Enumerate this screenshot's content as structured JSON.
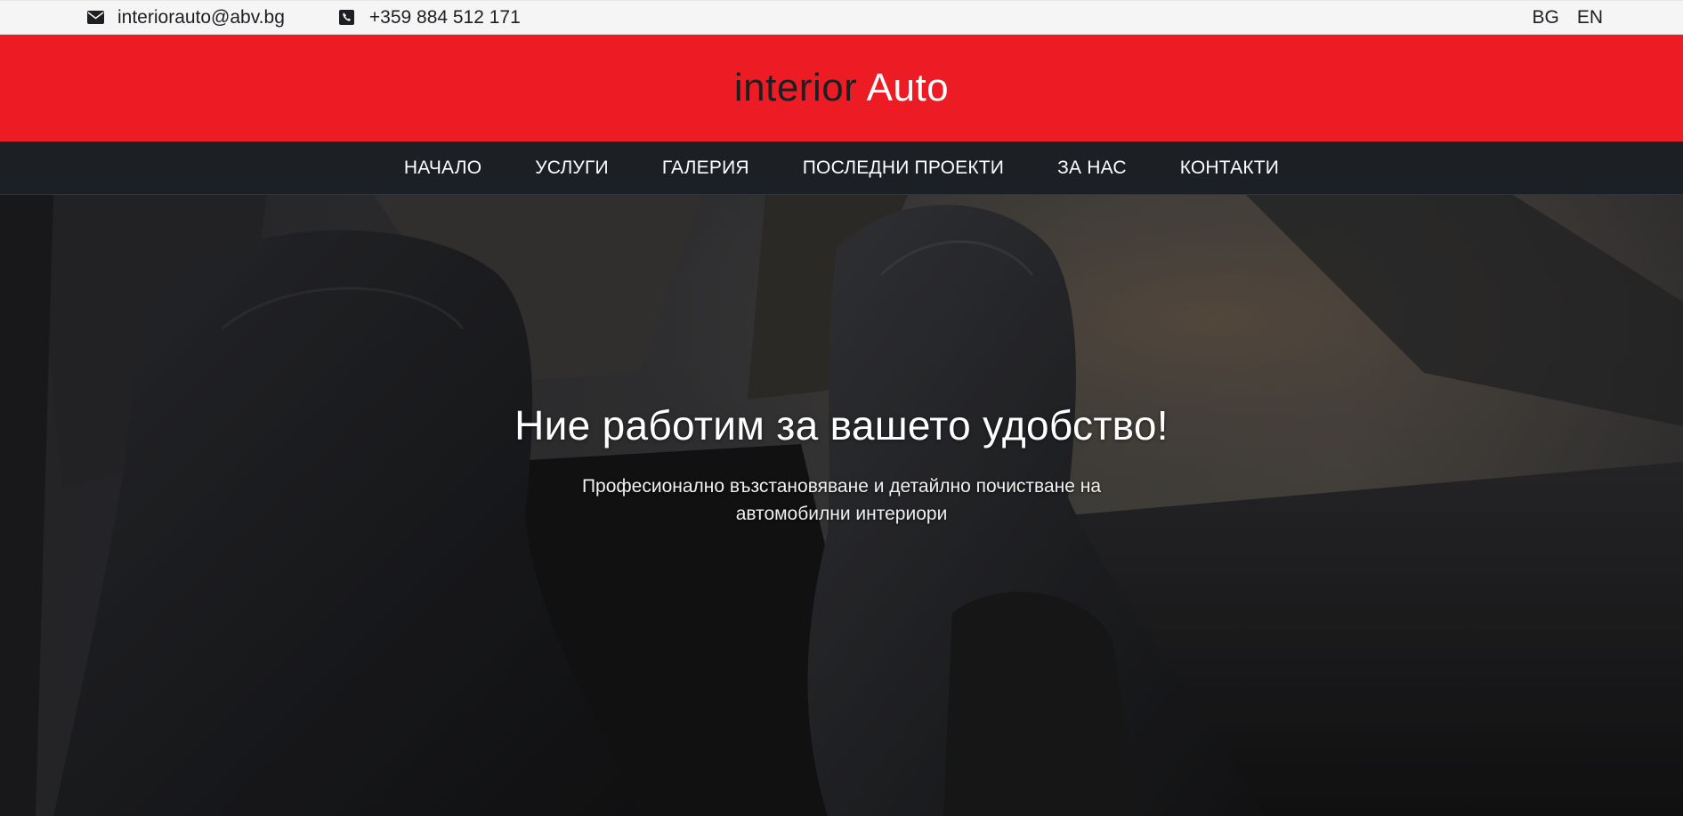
{
  "topbar": {
    "email": "interiorauto@abv.bg",
    "email_icon": "envelope-icon",
    "phone": "+359 884 512 171",
    "phone_icon": "phone-icon",
    "languages": [
      "BG",
      "EN"
    ]
  },
  "brand": {
    "part1": "interior",
    "part2": "Auto",
    "color_dark": "#1d1f23",
    "color_light": "#ffffff",
    "background": "#ed1c24"
  },
  "nav": {
    "items": [
      "НАЧАЛО",
      "УСЛУГИ",
      "ГАЛЕРИЯ",
      "ПОСЛЕДНИ ПРОЕКТИ",
      "ЗА НАС",
      "КОНТАКТИ"
    ],
    "background": "#1c1f24"
  },
  "hero": {
    "title": "Ние работим за вашето удобство!",
    "subtitle": "Професионално възстановяване и детайлно почистване на автомобилни интериори",
    "image": "black-leather-car-seats-photo"
  }
}
